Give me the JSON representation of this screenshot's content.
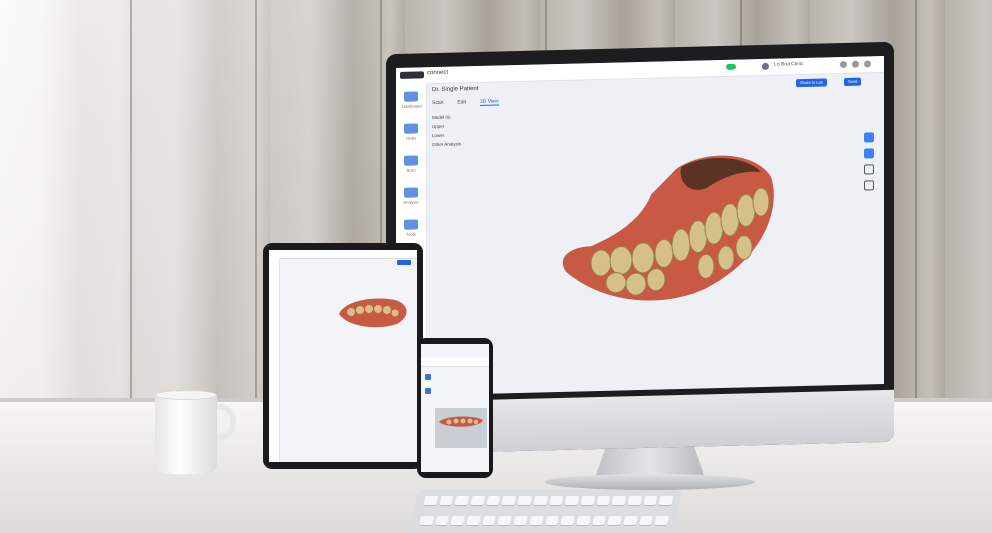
{
  "scene": {
    "description_objects": [
      "wall",
      "desk",
      "monitor",
      "tablet",
      "phone",
      "mug",
      "keyboard"
    ]
  },
  "app": {
    "name": "connect",
    "patient": "Dr. Single Patient",
    "user_label": "Lo Boa Clinic",
    "tabs": [
      "Scan",
      "Edit",
      "3D View"
    ],
    "active_tab": "3D View",
    "tree_items": [
      "Model 00",
      "Upper",
      "Lower",
      "Other Analysis"
    ],
    "buttons": [
      "Share to Lab",
      "Send"
    ],
    "sidebar_items": [
      "Dashboard",
      "Order",
      "Scan",
      "Analysis",
      "Tools"
    ]
  },
  "colors": {
    "accent": "#2563eb",
    "gum": "#d9573f",
    "tooth": "#d9c48f"
  }
}
